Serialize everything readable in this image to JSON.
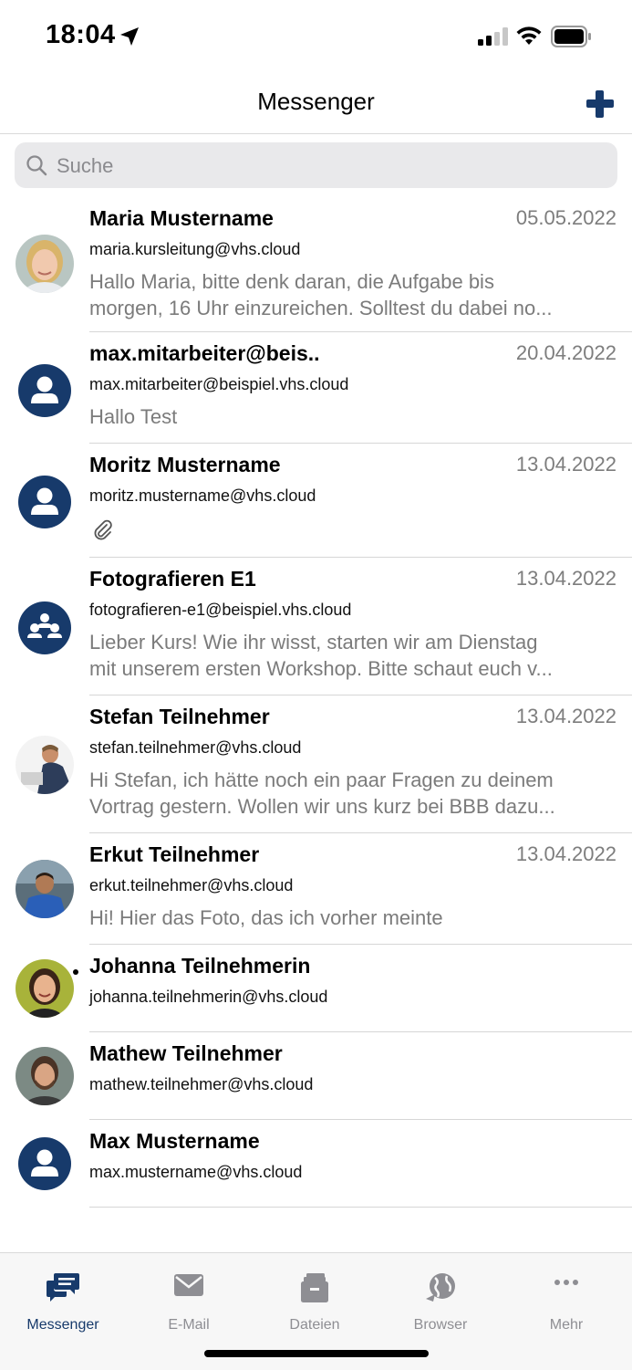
{
  "status_bar": {
    "time": "18:04"
  },
  "header": {
    "title": "Messenger"
  },
  "search": {
    "placeholder": "Suche"
  },
  "colors": {
    "accent": "#173a6b",
    "inactive": "#8e8e93"
  },
  "chats": [
    {
      "name": "Maria Mustername",
      "date": "05.05.2022",
      "email": "maria.kursleitung@vhs.cloud",
      "preview": [
        "Hallo Maria, bitte denk daran, die Aufgabe bis",
        "morgen, 16 Uhr einzureichen. Solltest du dabei no..."
      ],
      "avatar": "photo-woman-blonde"
    },
    {
      "name": "max.mitarbeiter@beis..",
      "date": "20.04.2022",
      "email": "max.mitarbeiter@beispiel.vhs.cloud",
      "preview": [
        "Hallo Test"
      ],
      "avatar": "person-icon"
    },
    {
      "name": "Moritz Mustername",
      "date": "13.04.2022",
      "email": "moritz.mustername@vhs.cloud",
      "preview": [],
      "attachment": "paperclip-icon",
      "avatar": "person-icon"
    },
    {
      "name": "Fotografieren E1",
      "date": "13.04.2022",
      "email": "fotografieren-e1@beispiel.vhs.cloud",
      "preview": [
        "Lieber Kurs! Wie ihr wisst, starten wir am Dienstag",
        "mit unserem ersten Workshop. Bitte schaut euch v..."
      ],
      "avatar": "group-icon"
    },
    {
      "name": "Stefan Teilnehmer",
      "date": "13.04.2022",
      "email": "stefan.teilnehmer@vhs.cloud",
      "preview": [
        "Hi Stefan, ich hätte noch ein paar Fragen zu deinem",
        "Vortrag gestern. Wollen wir uns kurz bei BBB dazu..."
      ],
      "avatar": "photo-man-laptop"
    },
    {
      "name": "Erkut Teilnehmer",
      "date": "13.04.2022",
      "email": "erkut.teilnehmer@vhs.cloud",
      "preview": [
        "Hi! Hier das Foto, das ich vorher meinte"
      ],
      "avatar": "photo-man-blue"
    },
    {
      "name": "Johanna Teilnehmerin",
      "date": "",
      "email": "johanna.teilnehmerin@vhs.cloud",
      "preview": [],
      "avatar": "photo-woman-dark",
      "unread": true
    },
    {
      "name": "Mathew Teilnehmer",
      "date": "",
      "email": "mathew.teilnehmer@vhs.cloud",
      "preview": [],
      "avatar": "photo-man-beard"
    },
    {
      "name": "Max Mustername",
      "date": "",
      "email": "max.mustername@vhs.cloud",
      "preview": [],
      "avatar": "person-icon"
    }
  ],
  "tabs": [
    {
      "label": "Messenger",
      "icon": "chat-bubbles-icon",
      "active": true
    },
    {
      "label": "E-Mail",
      "icon": "envelope-icon"
    },
    {
      "label": "Dateien",
      "icon": "files-icon"
    },
    {
      "label": "Browser",
      "icon": "globe-icon"
    },
    {
      "label": "Mehr",
      "icon": "more-dots-icon"
    }
  ]
}
